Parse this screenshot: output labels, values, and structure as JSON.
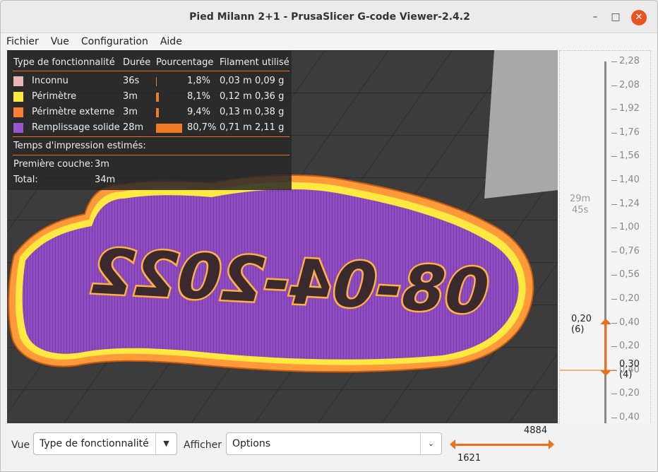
{
  "window": {
    "title": "Pied Milann 2+1 - PrusaSlicer G-code Viewer-2.4.2",
    "minimize_glyph": "–",
    "maximize_glyph": "□",
    "close_glyph": "✕"
  },
  "menu": [
    "Fichier",
    "Vue",
    "Configuration",
    "Aide"
  ],
  "legend": {
    "headers": {
      "type": "Type de fonctionnalité",
      "duration": "Durée",
      "percent": "Pourcentage",
      "filament": "Filament utilisé"
    },
    "rows": [
      {
        "name": "Inconnu",
        "color": "#e8b6b6",
        "duration": "36s",
        "fraction": 0.018,
        "percent": "1,8%",
        "length": "0,03 m",
        "weight": "0,09 g"
      },
      {
        "name": "Périmètre",
        "color": "#ffe840",
        "duration": "3m",
        "fraction": 0.081,
        "percent": "8,1%",
        "length": "0,12 m",
        "weight": "0,36 g"
      },
      {
        "name": "Périmètre externe",
        "color": "#ff7d38",
        "duration": "3m",
        "fraction": 0.094,
        "percent": "9,4%",
        "length": "0,13 m",
        "weight": "0,38 g"
      },
      {
        "name": "Remplissage solide",
        "color": "#9a57cc",
        "duration": "28m",
        "fraction": 0.807,
        "percent": "80,7%",
        "length": "0,71 m",
        "weight": "2,11 g"
      }
    ],
    "estimate_title": "Temps d'impression estimés:",
    "first_layer_label": "Première couche:",
    "first_layer_value": "3m",
    "total_label": "Total:",
    "total_value": "34m"
  },
  "model_text": "08-04-2022",
  "vertical_slider": {
    "ticks": [
      "2,28",
      "2,08",
      "1,92",
      "1,76",
      "1,56",
      "1,40",
      "1,24",
      "1,00",
      "0,76",
      "0,56",
      "0,20",
      "0,40",
      "0,20",
      "0,40",
      "0,20",
      "0,40"
    ],
    "time_line1": "29m",
    "time_line2": "45s",
    "upper_value": "0,20",
    "upper_layer": "(6)",
    "lower_value": "0,30",
    "lower_layer": "(4)"
  },
  "bottom": {
    "view_label": "Vue",
    "view_value": "Type de fonctionnalité",
    "show_label": "Afficher",
    "show_value": "Options",
    "h_max": "4884",
    "h_min": "1621"
  },
  "colors": {
    "accent": "#e8701f",
    "infill": "#9a57cc",
    "perimeter": "#ffe840",
    "external_perimeter": "#ff7d38"
  }
}
